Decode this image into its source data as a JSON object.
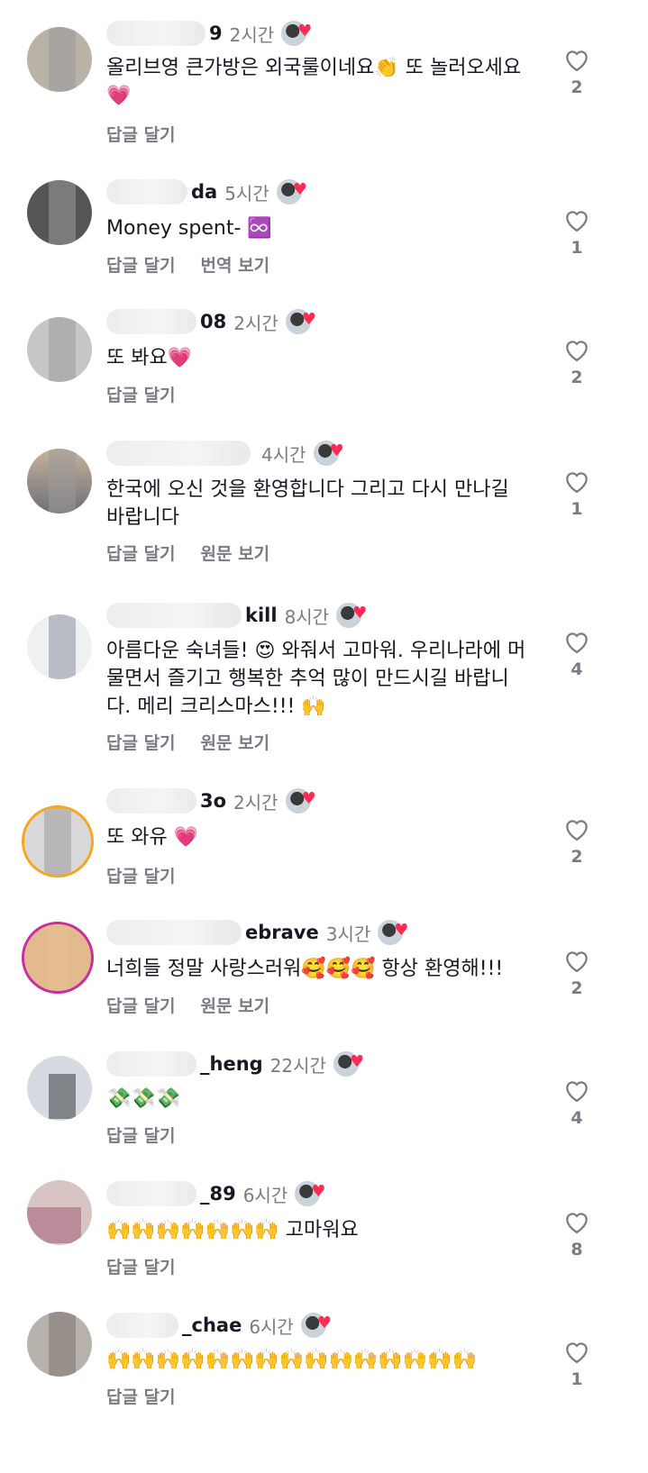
{
  "comments": [
    {
      "name_visible": "9",
      "time": "2시간",
      "text": "올리브영 큰가방은 외국룰이네요👏 또 놀러오세요💗",
      "actions": [
        "답글 달기"
      ],
      "likes": "2"
    },
    {
      "name_visible": "da",
      "time": "5시간",
      "text": "Money spent- ♾️",
      "actions": [
        "답글 달기",
        "번역 보기"
      ],
      "likes": "1"
    },
    {
      "name_visible": "08",
      "time": "2시간",
      "text": "또 봐요💗",
      "actions": [
        "답글 달기"
      ],
      "likes": "2"
    },
    {
      "name_visible": "",
      "time": "4시간",
      "text": "한국에 오신 것을 환영합니다 그리고 다시 만나길 바랍니다",
      "actions": [
        "답글 달기",
        "원문 보기"
      ],
      "likes": "1"
    },
    {
      "name_visible": "kill",
      "time": "8시간",
      "text": "아름다운 숙녀들! 😍 와줘서 고마워. 우리나라에 머물면서 즐기고 행복한 추억 많이 만드시길 바랍니다. 메리 크리스마스!!! 🙌",
      "actions": [
        "답글 달기",
        "원문 보기"
      ],
      "likes": "4"
    },
    {
      "name_visible": "3o",
      "time": "2시간",
      "text": "또 와유 💗",
      "actions": [
        "답글 달기"
      ],
      "likes": "2"
    },
    {
      "name_visible": "ebrave",
      "time": "3시간",
      "text": "너희들 정말 사랑스러워🥰🥰🥰 항상 환영해!!!",
      "actions": [
        "답글 달기",
        "원문 보기"
      ],
      "likes": "2"
    },
    {
      "name_visible": "_heng",
      "time": "22시간",
      "text": "💸💸💸",
      "actions": [
        "답글 달기"
      ],
      "likes": "4"
    },
    {
      "name_visible": "_89",
      "time": "6시간",
      "text": "🙌🙌🙌🙌🙌🙌🙌 고마워요",
      "actions": [
        "답글 달기"
      ],
      "likes": "8"
    },
    {
      "name_visible": "_chae",
      "time": "6시간",
      "text": "🙌🙌🙌🙌🙌🙌🙌🙌🙌🙌🙌🙌🙌🙌🙌",
      "actions": [
        "답글 달기"
      ],
      "likes": "1"
    }
  ],
  "colors": {
    "accent_heart": "#fe2c55",
    "muted_text": "#7a7c85",
    "primary_text": "#161823",
    "avatar_ring": "#f6a623"
  },
  "icons": {
    "like": "heart-outline-icon",
    "creator_liked": "creator-liked-heart-icon"
  }
}
